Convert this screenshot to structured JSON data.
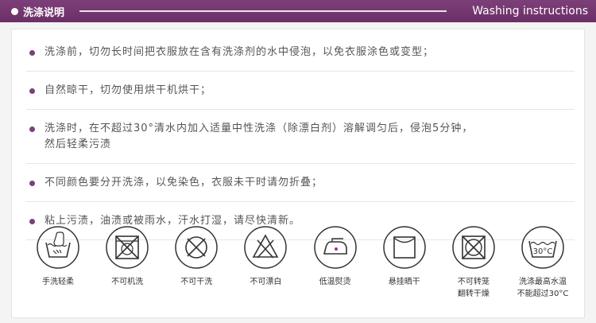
{
  "header": {
    "title": "洗涤说明",
    "subtitle": "Washing instructions"
  },
  "instructions": [
    "洗涤前，切勿长时间把衣服放在含有洗涤剂的水中侵泡，以免衣服涂色或变型；",
    "自然晾干，切勿使用烘干机烘干；",
    "洗涤时，在不超过30°清水内加入适量中性洗涤（除漂白剂）溶解调匀后，侵泡5分钟，\n然后轻柔污渍",
    "不同颜色要分开洗涤，以免染色，衣服未干时请勿折叠；",
    "粘上污渍，油渍或被雨水，汗水打湿，请尽快清新。"
  ],
  "care_icons": [
    {
      "icon": "hand-wash-icon",
      "label": "手洗轻柔"
    },
    {
      "icon": "no-machine-wash-icon",
      "label": "不可机洗"
    },
    {
      "icon": "no-dry-clean-icon",
      "label": "不可干洗"
    },
    {
      "icon": "no-bleach-icon",
      "label": "不可漂白"
    },
    {
      "icon": "low-iron-icon",
      "label": "低温熨烫"
    },
    {
      "icon": "hang-dry-icon",
      "label": "悬挂晒干"
    },
    {
      "icon": "no-tumble-dry-icon",
      "label": "不可转笼\n翻转干燥"
    },
    {
      "icon": "max-wash-30-icon",
      "label": "洗涤最高水温\n不能超过30°C",
      "temp": "30°C"
    }
  ]
}
